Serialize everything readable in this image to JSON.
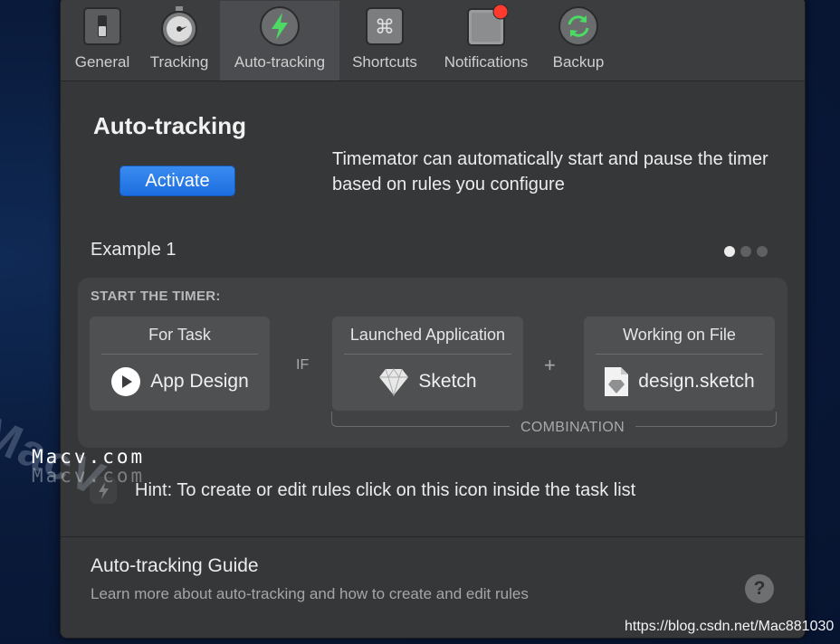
{
  "toolbar": {
    "tabs": [
      {
        "label": "General",
        "icon": "switch-icon"
      },
      {
        "label": "Tracking",
        "icon": "stopwatch-icon"
      },
      {
        "label": "Auto-tracking",
        "icon": "lightning-icon",
        "active": true
      },
      {
        "label": "Shortcuts",
        "icon": "command-key-icon"
      },
      {
        "label": "Notifications",
        "icon": "notification-icon"
      },
      {
        "label": "Backup",
        "icon": "sync-icon"
      }
    ]
  },
  "main": {
    "title": "Auto-tracking",
    "activate_label": "Activate",
    "description": "Timemator can automatically start and pause the timer based on rules you configure"
  },
  "example": {
    "label": "Example 1",
    "page_count": 3,
    "current_page": 1,
    "panel_heading": "START THE TIMER:",
    "task": {
      "header": "For Task",
      "value": "App Design"
    },
    "if_label": "IF",
    "app": {
      "header": "Launched Application",
      "value": "Sketch"
    },
    "plus_label": "+",
    "file": {
      "header": "Working on File",
      "value": "design.sketch"
    },
    "combination_label": "COMBINATION"
  },
  "hint": "Hint: To create or edit rules click on this icon inside the task list",
  "guide": {
    "title": "Auto-tracking Guide",
    "subtitle": "Learn more about auto-tracking and how to create and edit rules",
    "help_label": "?"
  },
  "watermark": {
    "big": "MacV",
    "small1": "Macv.com",
    "small2": "Macv.com",
    "credit": "https://blog.csdn.net/Mac881030"
  },
  "colors": {
    "accent": "#2a7de8",
    "active_green": "#4cd964",
    "badge_red": "#ff3b30"
  }
}
